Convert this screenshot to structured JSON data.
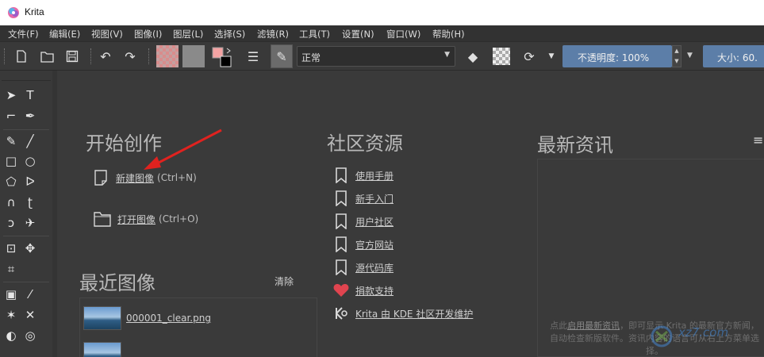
{
  "app": {
    "title": "Krita"
  },
  "menu": [
    "文件(F)",
    "编辑(E)",
    "视图(V)",
    "图像(I)",
    "图层(L)",
    "选择(S)",
    "滤镜(R)",
    "工具(T)",
    "设置(N)",
    "窗口(W)",
    "帮助(H)"
  ],
  "toolbar": {
    "blend_mode": "正常",
    "opacity_label": "不透明度:  100%",
    "size_label": "大小: 60."
  },
  "welcome": {
    "start": {
      "heading": "开始创作",
      "new_image": "新建图像",
      "new_image_shortcut": "(Ctrl+N)",
      "open_image": "打开图像",
      "open_image_shortcut": "(Ctrl+O)"
    },
    "recent": {
      "heading": "最近图像",
      "clear": "清除",
      "items": [
        {
          "file": "000001_clear.png"
        }
      ]
    },
    "community": {
      "heading": "社区资源",
      "links": [
        "使用手册",
        "新手入门",
        "用户社区",
        "官方网站",
        "源代码库",
        "捐款支持",
        "Krita 由 KDE 社区开发维护"
      ]
    },
    "news": {
      "heading": "最新资讯",
      "note_pre": "点此",
      "note_link": "启用最新资讯",
      "note_post": "，即可显示 Krita 的最新官方新闻，自动检查新版软件。资讯内容的语言可从右上方菜单选择。"
    }
  },
  "watermark": "xz7.com",
  "colors": {
    "accent": "#5c7ea8",
    "heart": "#e0444f",
    "arrow": "#e0221f"
  }
}
